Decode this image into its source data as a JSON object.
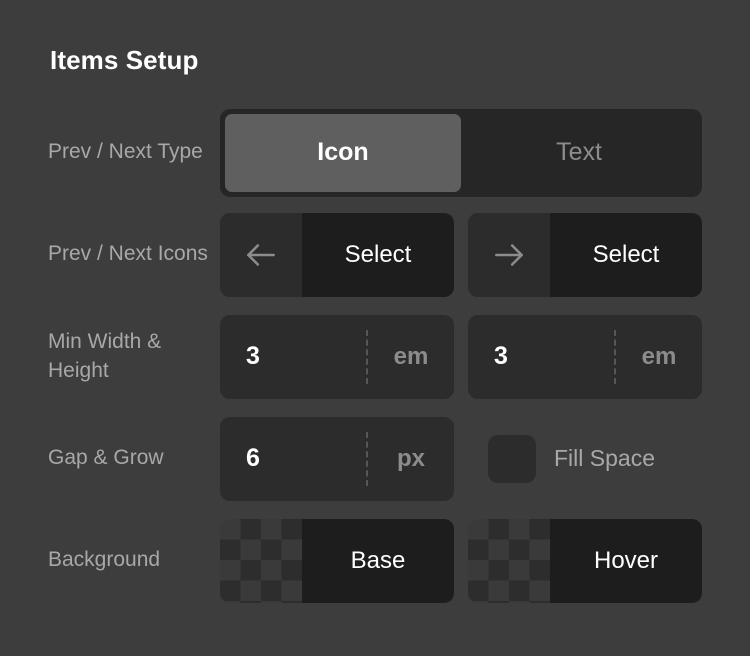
{
  "header": {
    "title": "Items Setup"
  },
  "rows": [
    {
      "label": "Prev / Next Type",
      "control": "segmented",
      "segments": [
        {
          "label": "Icon",
          "selected": true
        },
        {
          "label": "Text",
          "selected": false
        }
      ]
    },
    {
      "label": "Prev / Next Icons",
      "control": "icon-pickers",
      "prev": {
        "icon": "arrow-left-icon",
        "button_label": "Select"
      },
      "next": {
        "icon": "arrow-right-icon",
        "button_label": "Select"
      }
    },
    {
      "label": "Min Width & Height",
      "control": "numeric-pair",
      "min_width": {
        "value": "3",
        "unit": "em"
      },
      "min_height": {
        "value": "3",
        "unit": "em"
      }
    },
    {
      "label": "Gap & Grow",
      "control": "gap-and-grow",
      "gap": {
        "value": "6",
        "unit": "px"
      },
      "grow": {
        "checkbox_label": "Fill Space",
        "checked": false
      }
    },
    {
      "label": "Background",
      "control": "swatch-pair",
      "base": {
        "label": "Base",
        "swatch": "transparent-checkerboard"
      },
      "hover": {
        "label": "Hover",
        "swatch": "transparent-checkerboard"
      }
    }
  ],
  "colors": {
    "panel_background": "#3d3d3d",
    "title_text": "#ffffff",
    "label_text": "#a8a8a8",
    "field_background": "#2c2c2c",
    "button_background": "#1d1d1d",
    "segmented_track": "#262626",
    "segmented_active": "#5f5f5f",
    "divider": "#565656"
  }
}
